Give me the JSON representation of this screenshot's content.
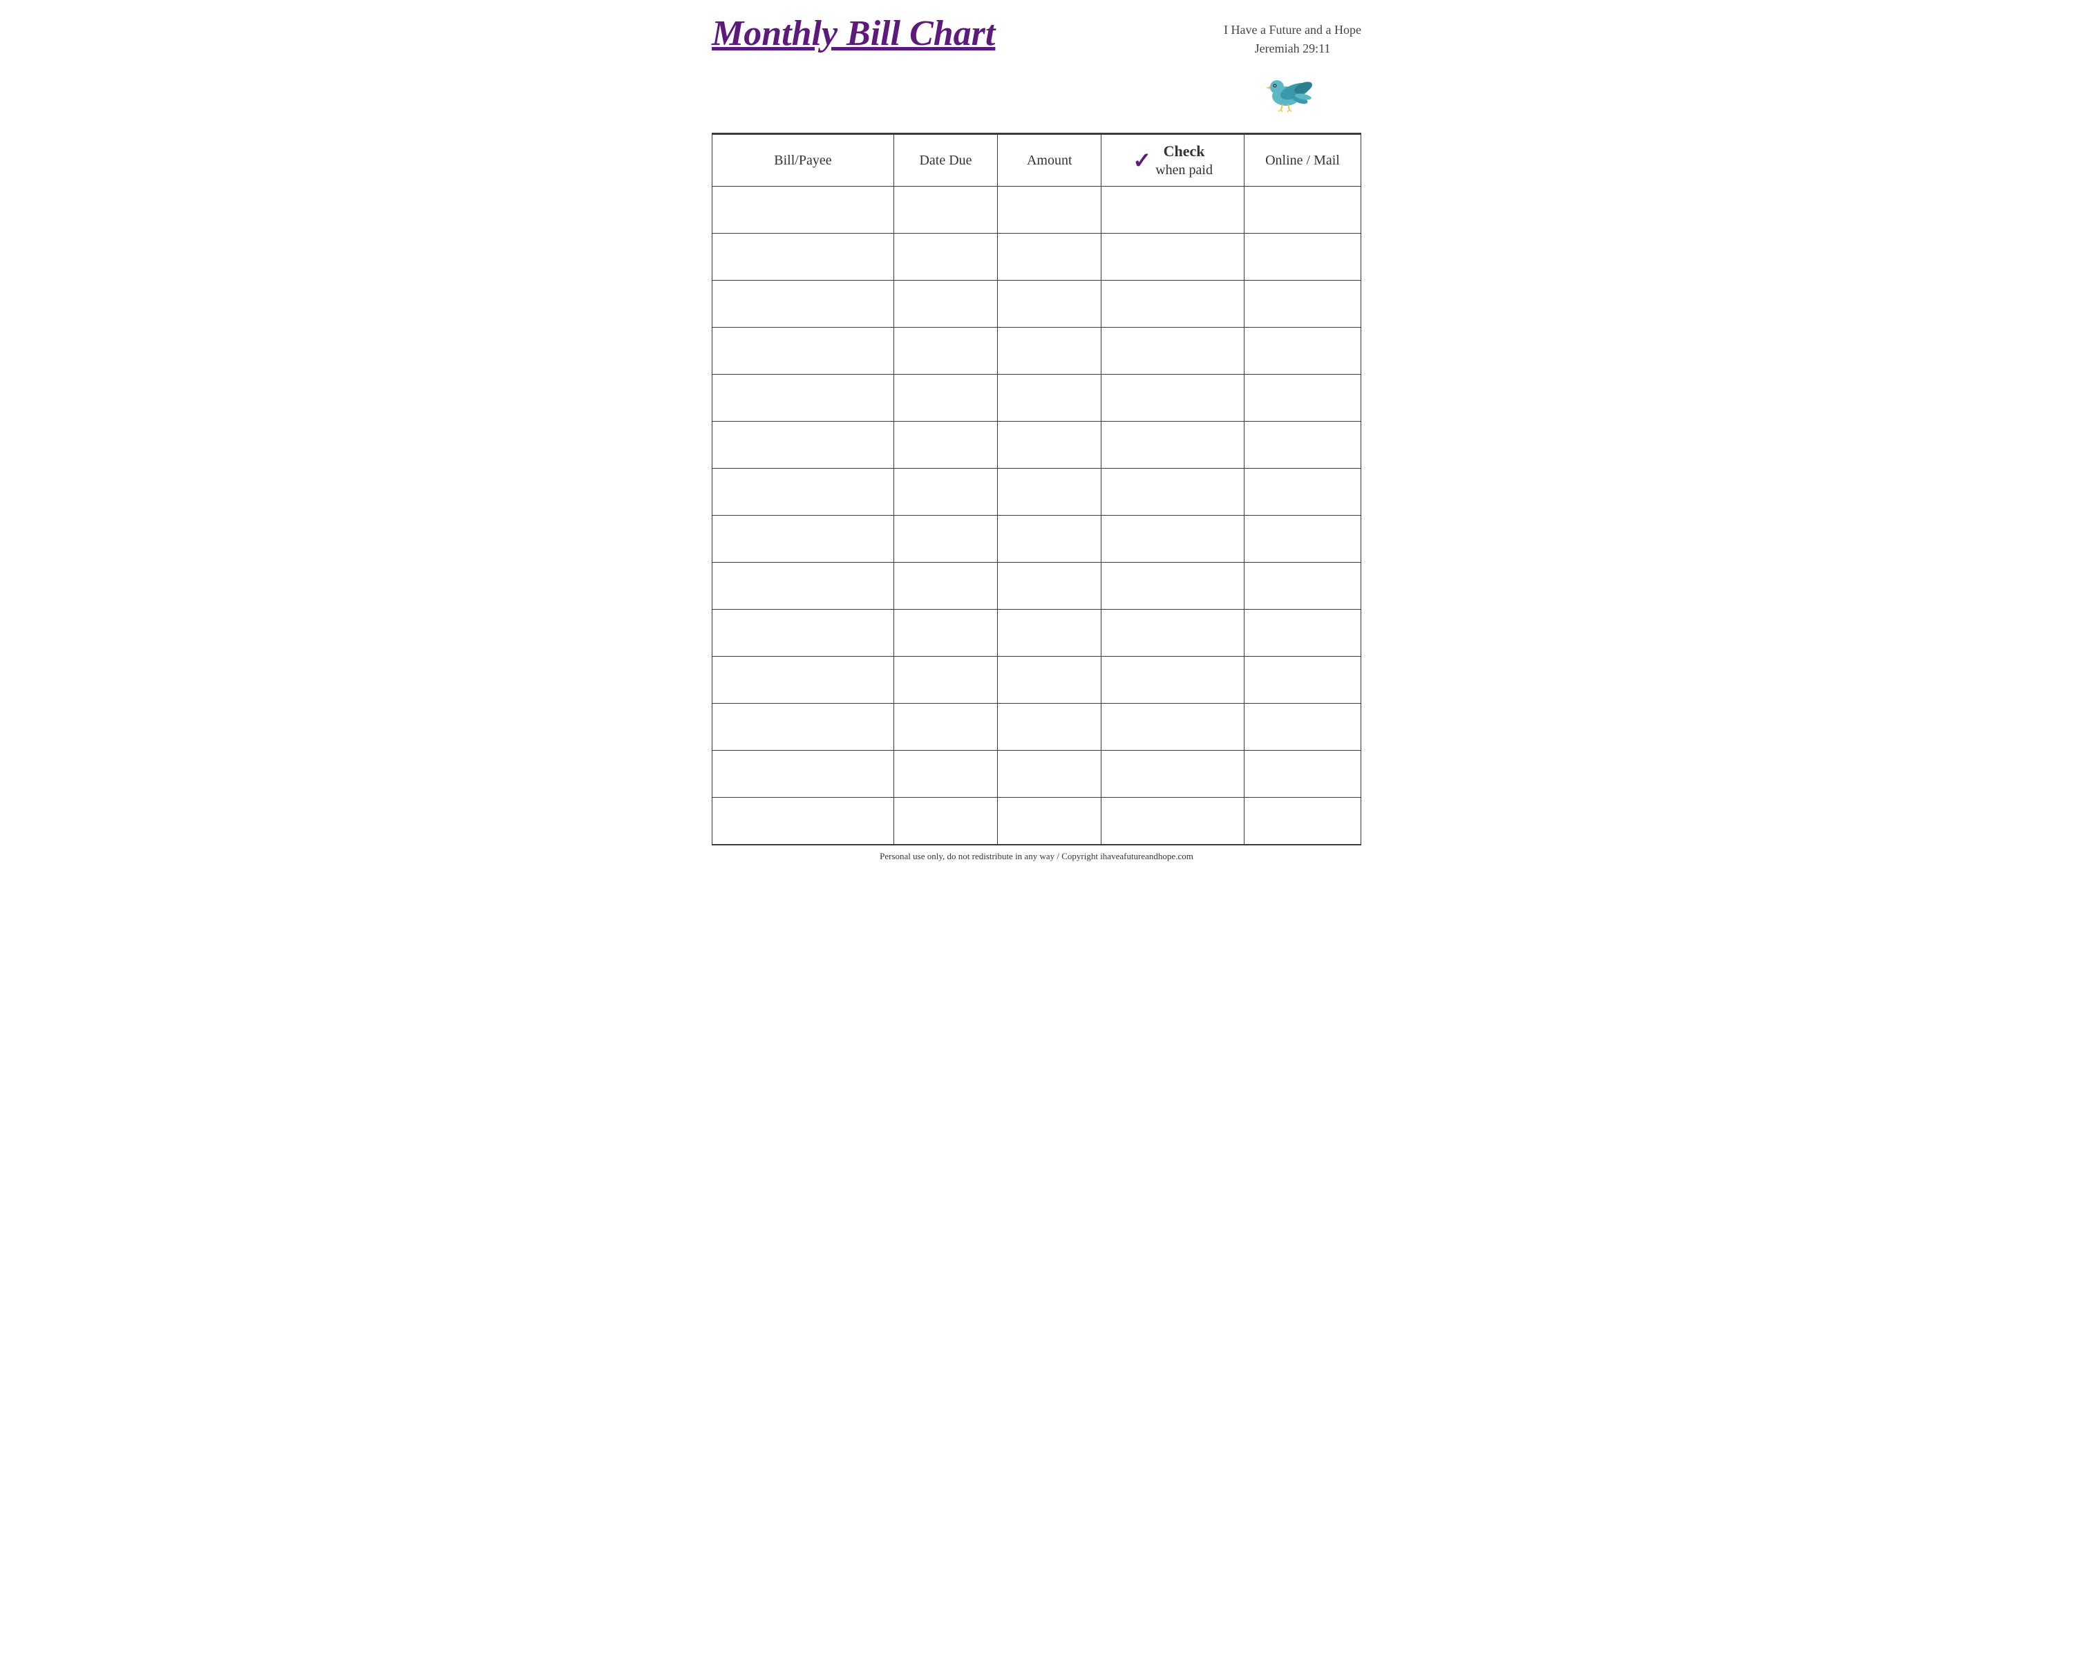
{
  "header": {
    "title": "Monthly Bill Chart",
    "verse_line1": "I Have a Future and a Hope",
    "verse_line2": "Jeremiah 29:11"
  },
  "table": {
    "columns": [
      {
        "id": "bill-payee",
        "label": "Bill/Payee"
      },
      {
        "id": "date-due",
        "label": "Date Due"
      },
      {
        "id": "amount",
        "label": "Amount"
      },
      {
        "id": "check-when-paid",
        "label_line1": "Check",
        "label_line2": "when paid",
        "has_checkmark": true
      },
      {
        "id": "online-mail",
        "label": "Online / Mail"
      }
    ],
    "row_count": 14
  },
  "footer": {
    "text": "Personal use only, do not redistribute in any way / Copyright ihaveafutureandhope.com"
  },
  "colors": {
    "title": "#5c1a7a",
    "checkmark": "#5c1a7a",
    "border": "#3a3a3a",
    "text": "#333333"
  }
}
